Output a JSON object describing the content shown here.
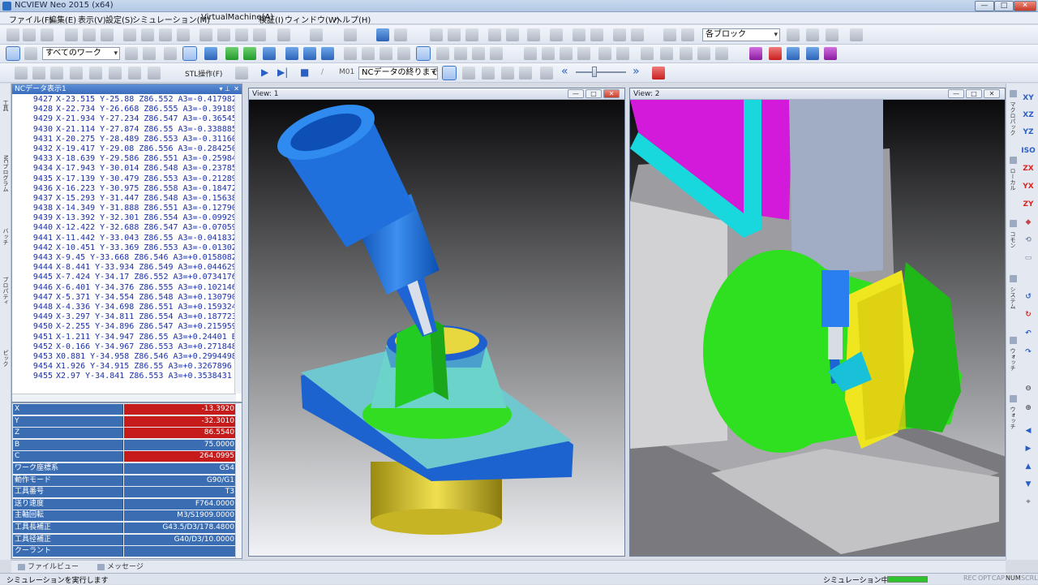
{
  "window": {
    "title": "NCVIEW Neo 2015 (x64)"
  },
  "menubar": [
    "ファイル(F)",
    "編集(E)",
    "表示(V)",
    "設定(S)",
    "シミュレーション(M)",
    "VirtualMachine(A)",
    "検証(I)",
    "ウィンドウ(W)",
    "ヘルプ(H)"
  ],
  "toolbar": {
    "block_combo": "各ブロック",
    "work_combo": "すべてのワーク",
    "stl_label": "STL操作(F)",
    "nc_end_combo": "NCデータの終りまで",
    "m01_label": "M01"
  },
  "nc_panel": {
    "title": "NCデータ表示1",
    "lines": [
      {
        "n": "9427",
        "code": "X-23.515 Y-25.88 Z86.552 A3=-0.417982"
      },
      {
        "n": "9428",
        "code": "X-22.734 Y-26.668 Z86.555 A3=-0.39189"
      },
      {
        "n": "9429",
        "code": "X-21.934 Y-27.234 Z86.547 A3=-0.36545"
      },
      {
        "n": "9430",
        "code": "X-21.114 Y-27.874 Z86.55 A3=-0.338885"
      },
      {
        "n": "9431",
        "code": "X-20.275 Y-28.489 Z86.553 A3=-0.31160"
      },
      {
        "n": "9432",
        "code": "X-19.417 Y-29.08 Z86.556 A3=-0.284250"
      },
      {
        "n": "9433",
        "code": "X-18.639 Y-29.586 Z86.551 A3=-0.25984"
      },
      {
        "n": "9434",
        "code": "X-17.943 Y-30.014 Z86.548 A3=-0.23785"
      },
      {
        "n": "9435",
        "code": "X-17.139 Y-30.479 Z86.553 A3=-0.21289"
      },
      {
        "n": "9436",
        "code": "X-16.223 Y-30.975 Z86.558 A3=-0.18472"
      },
      {
        "n": "9437",
        "code": "X-15.293 Y-31.447 Z86.548 A3=-0.15638"
      },
      {
        "n": "9438",
        "code": "X-14.349 Y-31.888 Z86.551 A3=-0.12790"
      },
      {
        "n": "9439",
        "code": "X-13.392 Y-32.301 Z86.554 A3=-0.09929"
      },
      {
        "n": "9440",
        "code": "X-12.422 Y-32.688 Z86.547 A3=-0.07059"
      },
      {
        "n": "9441",
        "code": "X-11.442 Y-33.043 Z86.55 A3=-0.041832"
      },
      {
        "n": "9442",
        "code": "X-10.451 Y-33.369 Z86.553 A3=-0.01302"
      },
      {
        "n": "9443",
        "code": "X-9.45 Y-33.668 Z86.546 A3=+0.0158082"
      },
      {
        "n": "9444",
        "code": "X-8.441 Y-33.934 Z86.549 A3=+0.044629"
      },
      {
        "n": "9445",
        "code": "X-7.424 Y-34.17 Z86.552 A3=+0.0734176"
      },
      {
        "n": "9446",
        "code": "X-6.401 Y-34.376 Z86.555 A3=+0.102146"
      },
      {
        "n": "9447",
        "code": "X-5.371 Y-34.554 Z86.548 A3=+0.130790"
      },
      {
        "n": "9448",
        "code": "X-4.336 Y-34.698 Z86.551 A3=+0.159324"
      },
      {
        "n": "9449",
        "code": "X-3.297 Y-34.811 Z86.554 A3=+0.187723"
      },
      {
        "n": "9450",
        "code": "X-2.255 Y-34.896 Z86.547 A3=+0.215959"
      },
      {
        "n": "9451",
        "code": "X-1.211 Y-34.947 Z86.55 A3=+0.24401 B"
      },
      {
        "n": "9452",
        "code": "X-0.166 Y-34.967 Z86.553 A3=+0.271848"
      },
      {
        "n": "9453",
        "code": "X0.881 Y-34.958 Z86.546 A3=+0.2994498"
      },
      {
        "n": "9454",
        "code": "X1.926 Y-34.915 Z86.55 A3=+0.3267896"
      },
      {
        "n": "9455",
        "code": "X2.97 Y-34.841 Z86.553 A3=+0.3538431"
      }
    ]
  },
  "status_table": [
    {
      "label": "X",
      "value": "-13.3920",
      "highlight": "red"
    },
    {
      "label": "Y",
      "value": "-32.3010",
      "highlight": "red"
    },
    {
      "label": "Z",
      "value": "86.5540",
      "highlight": "red"
    },
    {
      "label": "B",
      "value": "75.0000",
      "highlight": "blue"
    },
    {
      "label": "C",
      "value": "264.0995",
      "highlight": "red"
    },
    {
      "label": "ワーク座標系",
      "value": "G54",
      "highlight": "blue"
    },
    {
      "label": "動作モード",
      "value": "G90/G1",
      "highlight": "blue"
    },
    {
      "label": "工具番号",
      "value": "T3",
      "highlight": "blue"
    },
    {
      "label": "送り速度",
      "value": "F764.0000",
      "highlight": "blue"
    },
    {
      "label": "主軸回転",
      "value": "M3/S1909.0000",
      "highlight": "blue"
    },
    {
      "label": "工具長補正",
      "value": "G43.5/D3/178.4800",
      "highlight": "blue"
    },
    {
      "label": "工具径補正",
      "value": "G40/D3/10.0000",
      "highlight": "blue"
    },
    {
      "label": "クーラント",
      "value": "",
      "highlight": "blue"
    }
  ],
  "bottom_tabs": [
    "ファイルビュー",
    "メッセージ"
  ],
  "views": [
    {
      "title": "View: 1"
    },
    {
      "title": "View: 2"
    }
  ],
  "right_toolbar": [
    "XY",
    "XZ",
    "YZ",
    "ISO",
    "ZX",
    "YX",
    "ZY"
  ],
  "statusbar": {
    "message": "シミュレーションを実行します",
    "sim_state": "シミュレーション中",
    "indicators": [
      "REC",
      "OPT",
      "CAP",
      "NUM",
      "SCRL"
    ]
  },
  "colors": {
    "header_blue": "#3b6db3",
    "value_red": "#c51b1b",
    "nc_text": "#1a2fa8"
  }
}
